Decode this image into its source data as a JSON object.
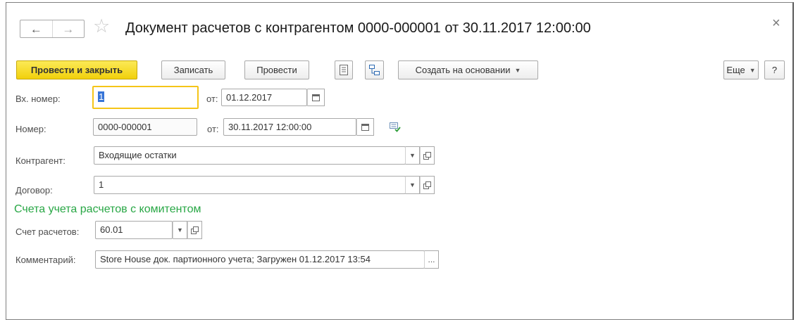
{
  "window": {
    "title": "Документ расчетов с контрагентом 0000-000001 от 30.11.2017 12:00:00",
    "back_icon": "←",
    "forward_icon": "→",
    "star_icon": "☆",
    "close_icon": "×"
  },
  "toolbar": {
    "post_and_close": "Провести и закрыть",
    "save": "Записать",
    "post": "Провести",
    "create_based_on": "Создать на основании",
    "more": "Еще",
    "help": "?",
    "dropdown_caret": "▼"
  },
  "form": {
    "in_number": {
      "label": "Вх. номер:",
      "value": "1",
      "date_label": "от:",
      "date_value": "01.12.2017"
    },
    "number": {
      "label": "Номер:",
      "value": "0000-000001",
      "date_label": "от:",
      "date_value": "30.11.2017 12:00:00"
    },
    "counterparty": {
      "label": "Контрагент:",
      "value": "Входящие остатки"
    },
    "contract": {
      "label": "Договор:",
      "value": "1"
    },
    "section_title": "Счета учета расчетов с комитентом",
    "account": {
      "label": "Счет расчетов:",
      "value": "60.01"
    },
    "comment": {
      "label": "Комментарий:",
      "value": "Store House док. партионного учета; Загружен 01.12.2017 13:54",
      "more_button": "..."
    }
  },
  "colors": {
    "primary_button": "#f1d00b",
    "section_title": "#28a745",
    "focus_border": "#f5c518"
  }
}
